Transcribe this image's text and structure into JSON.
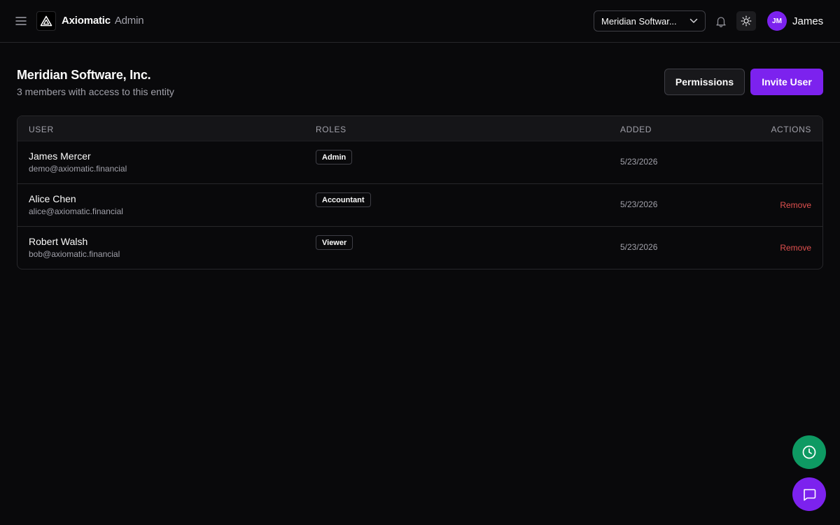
{
  "header": {
    "brand_name": "Axiomatic",
    "brand_suffix": "Admin",
    "entity_selector": "Meridian Softwar...",
    "user_initials": "JM",
    "user_name": "James",
    "icons": {
      "menu": "menu-icon",
      "logo": "triangle-logo-icon",
      "chevron": "chevron-down-icon",
      "bell": "bell-icon",
      "theme": "sun-icon"
    }
  },
  "page": {
    "title": "Meridian Software, Inc.",
    "subtitle": "3 members with access to this entity",
    "permissions_label": "Permissions",
    "invite_label": "Invite User"
  },
  "table": {
    "columns": {
      "user": "USER",
      "roles": "ROLES",
      "added": "ADDED",
      "actions": "ACTIONS"
    },
    "rows": [
      {
        "name": "James Mercer",
        "email": "demo@axiomatic.financial",
        "role": "Admin",
        "added": "5/23/2026",
        "action": ""
      },
      {
        "name": "Alice Chen",
        "email": "alice@axiomatic.financial",
        "role": "Accountant",
        "added": "5/23/2026",
        "action": "Remove"
      },
      {
        "name": "Robert Walsh",
        "email": "bob@axiomatic.financial",
        "role": "Viewer",
        "added": "5/23/2026",
        "action": "Remove"
      }
    ]
  },
  "fabs": {
    "clock_icon": "clock-icon",
    "chat_icon": "chat-icon"
  },
  "colors": {
    "background": "#09090b",
    "accent": "#7c22ee",
    "success": "#0e9a63",
    "danger": "#e0504e"
  }
}
